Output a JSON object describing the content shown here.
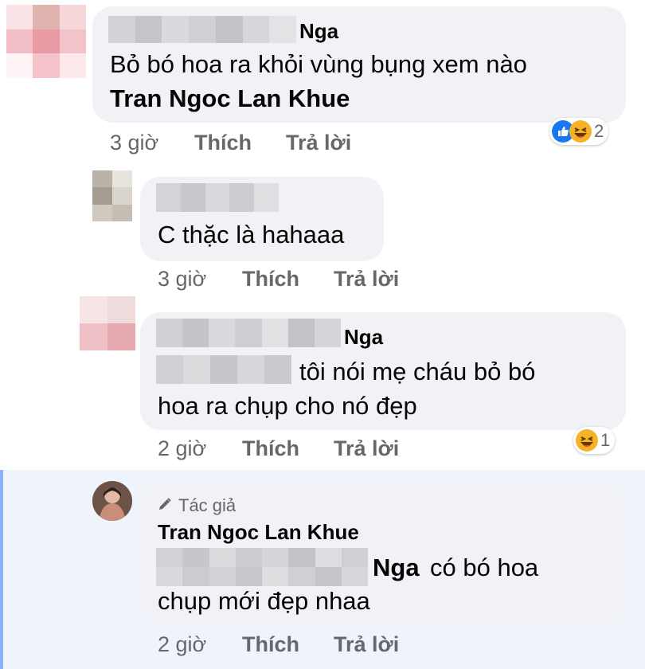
{
  "colors": {
    "bubble": "#f0f2f5",
    "meta_text": "#65676b",
    "like_blue": "#1877f2",
    "haha_yellow": "#f7b125",
    "highlight_bg": "#eef3fc",
    "accent": "#8ab4f8"
  },
  "comments": [
    {
      "author_suffix": "Nga",
      "text": "Bỏ bó hoa ra khỏi vùng bụng xem nào",
      "mention": "Tran Ngoc Lan Khue",
      "time": "3 giờ",
      "like_label": "Thích",
      "reply_label": "Trả lời",
      "reactions": {
        "icons": [
          "like-icon",
          "haha-icon"
        ],
        "count": "2"
      }
    },
    {
      "text": "C thặc là hahaaa",
      "time": "3 giờ",
      "like_label": "Thích",
      "reply_label": "Trả lời"
    },
    {
      "author_suffix": "Nga",
      "text_line1": "tôi nói mẹ cháu bỏ bó",
      "text_line2": "hoa ra chụp cho nó đẹp",
      "time": "2 giờ",
      "like_label": "Thích",
      "reply_label": "Trả lời",
      "reactions": {
        "icons": [
          "haha-icon"
        ],
        "count": "1"
      }
    },
    {
      "badge_icon": "pencil-icon",
      "badge_label": "Tác giả",
      "author": "Tran Ngoc Lan Khue",
      "mention_suffix": "Nga",
      "text_line1": "có bó hoa",
      "text_line2": "chụp mới đẹp nhaa",
      "time": "2 giờ",
      "like_label": "Thích",
      "reply_label": "Trả lời"
    }
  ]
}
